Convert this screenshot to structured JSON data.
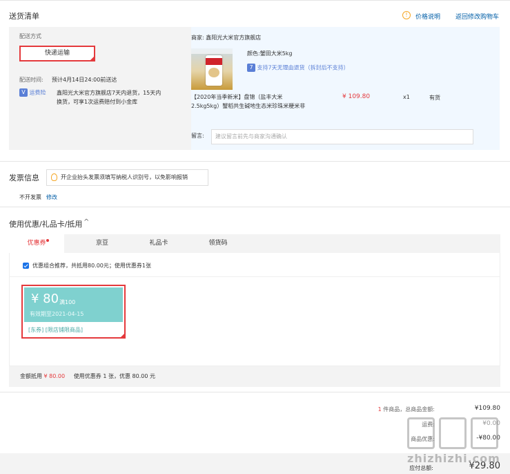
{
  "header": {
    "title": "送货清单",
    "price_info": "价格说明",
    "back_cart": "返回修改购物车"
  },
  "delivery": {
    "label": "配送方式",
    "method": "快递运输",
    "time_label": "配送时间:",
    "time_value": "预计4月14日24:00前送达",
    "freight_tag": "运费险",
    "freight_text_1": "鑫阳光大米官方旗舰店7天内退货，15天内",
    "freight_text_2": "换货，可享1次运费赔付到小金库"
  },
  "shop": {
    "label": "商家:",
    "name": "鑫阳光大米官方旗舰店",
    "color_label": "颜色:",
    "color_value": "蟹田大米5kg",
    "return_tag": "7",
    "return_text": "支持7天无理由退货（拆封后不支持）",
    "product_name_1": "【2020年当季新米】盘锦（盐丰大米",
    "product_name_2": "2.5kg5kg）蟹稻共生碱地生态米珍珠米粳米非",
    "price": "¥ 109.80",
    "qty": "x1",
    "stock": "有货",
    "remark_label": "留言:",
    "remark_placeholder": "建议留言前先与商家沟通确认"
  },
  "invoice": {
    "title": "发票信息",
    "tip": "开企业抬头发票须填写纳税人识别号，以免影响报销",
    "value": "不开发票",
    "edit": "修改"
  },
  "discount": {
    "title": "使用优惠/礼品卡/抵用",
    "tabs": [
      "优惠券",
      "京豆",
      "礼品卡",
      "领货码"
    ],
    "recommend": "优惠组合推荐，共抵用80.00元；使用优惠券1张",
    "coupon": {
      "amount": "¥ 80",
      "condition": "满100",
      "date": "有效期至2021-04-15",
      "tags": "[东券]  [限店铺限商品]"
    },
    "summary_label": "金额抵用",
    "summary_amount": "¥ 80.00",
    "summary_detail": "使用优惠券 1 张，优惠 80.00 元"
  },
  "totals": {
    "count": "1",
    "count_label": "件商品，总商品金额:",
    "goods_total": "¥109.80",
    "freight_label": "运费:",
    "freight_value": "¥0.00",
    "discount_label": "商品优惠:",
    "discount_value": "-¥80.00",
    "pay_label": "应付总额:",
    "pay_value": "¥29.80"
  },
  "watermark": "zhizhizhi.com",
  "colors": {
    "accent_red": "#e4393c",
    "coupon_teal": "#7fd1cf",
    "link_blue": "#005ea7"
  }
}
